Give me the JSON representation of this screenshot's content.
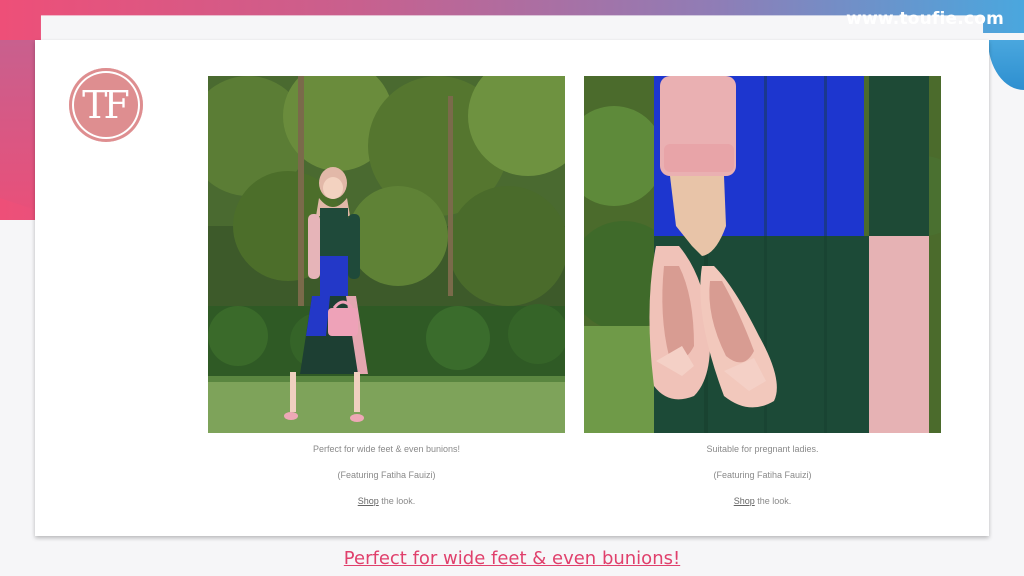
{
  "header": {
    "site_url": "www.toufie.com"
  },
  "logo": {
    "text": "TF",
    "color": "#de8e90"
  },
  "products": [
    {
      "caption": "Perfect for wide feet & even bunions!",
      "featuring": "(Featuring Fatiha Fauizi)",
      "shop_link": "Shop",
      "shop_suffix": " the look."
    },
    {
      "caption": "Suitable for pregnant ladies.",
      "featuring": "(Featuring Fatiha Fauizi)",
      "shop_link": "Shop",
      "shop_suffix": " the look."
    }
  ],
  "footer": {
    "caption_link": "Perfect for wide feet & even bunions!"
  },
  "colors": {
    "accent_pink": "#e0406c",
    "gradient_start": "#ee4f78",
    "gradient_end": "#4aa7de"
  }
}
